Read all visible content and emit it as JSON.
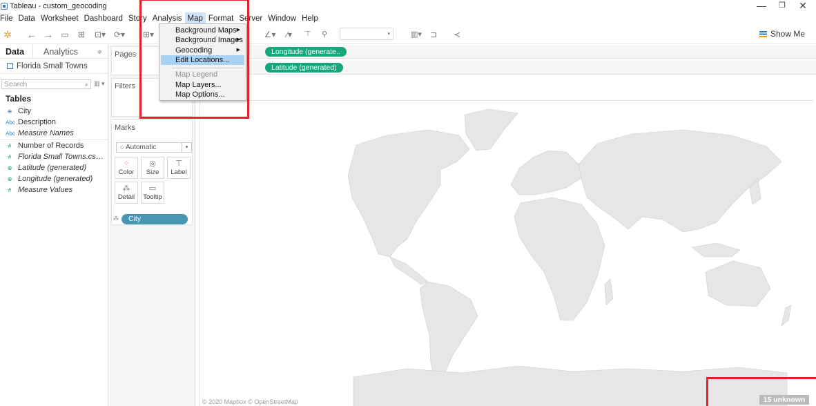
{
  "window": {
    "title": "Tableau - custom_geocoding",
    "controls": [
      "—",
      "❐",
      "✕"
    ]
  },
  "menubar": [
    {
      "label": "File"
    },
    {
      "label": "Data"
    },
    {
      "label": "Worksheet"
    },
    {
      "label": "Dashboard"
    },
    {
      "label": "Story"
    },
    {
      "label": "Analysis"
    },
    {
      "label": "Map",
      "active": true
    },
    {
      "label": "Format"
    },
    {
      "label": "Server"
    },
    {
      "label": "Window"
    },
    {
      "label": "Help"
    }
  ],
  "map_menu": {
    "items": [
      {
        "label": "Background Maps",
        "submenu": true
      },
      {
        "label": "Background Images",
        "submenu": true
      },
      {
        "label": "Geocoding",
        "submenu": true
      },
      {
        "label": "Edit Locations...",
        "highlighted": true
      },
      {
        "label": "Map Legend",
        "disabled": true
      },
      {
        "label": "Map Layers..."
      },
      {
        "label": "Map Options..."
      }
    ]
  },
  "toolbar": {
    "show_me": "Show Me"
  },
  "data_pane": {
    "tab_data": "Data",
    "tab_analytics": "Analytics",
    "datasource": "Florida Small Towns",
    "search_placeholder": "Search",
    "tables_header": "Tables",
    "fields": [
      {
        "label": "City",
        "icon": "⊕",
        "kind": "dim"
      },
      {
        "label": "Description",
        "icon": "Abc",
        "kind": "dim"
      },
      {
        "label": "Measure Names",
        "icon": "Abc",
        "kind": "dim",
        "italic": true
      },
      {
        "label": "Number of Records",
        "icon": "#",
        "kind": "mea"
      },
      {
        "label": "Florida Small Towns.csv (C...",
        "icon": "#",
        "kind": "mea",
        "italic": true
      },
      {
        "label": "Latitude (generated)",
        "icon": "⊕",
        "kind": "mea",
        "italic": true
      },
      {
        "label": "Longitude (generated)",
        "icon": "⊕",
        "kind": "mea",
        "italic": true
      },
      {
        "label": "Measure Values",
        "icon": "#",
        "kind": "mea",
        "italic": true
      }
    ]
  },
  "cards": {
    "pages": "Pages",
    "filters": "Filters",
    "marks": "Marks",
    "mark_type": "Automatic",
    "buttons": [
      "Color",
      "Size",
      "Label",
      "Detail",
      "Tooltip"
    ],
    "city_pill": "City"
  },
  "shelves": {
    "columns_pill": "Longitude (generate..",
    "rows_pill": "Latitude (generated)"
  },
  "view": {
    "attribution": "© 2020 Mapbox © OpenStreetMap",
    "unknown_indicator": "15 unknown",
    "land_color": "#e6e6e6",
    "border_color": "#cfcfcf"
  },
  "accent": {
    "pill_green": "#16a67b",
    "pill_blue": "#4996b2",
    "highlight": "#a9d1f3",
    "annotation_red": "#e4202b"
  }
}
